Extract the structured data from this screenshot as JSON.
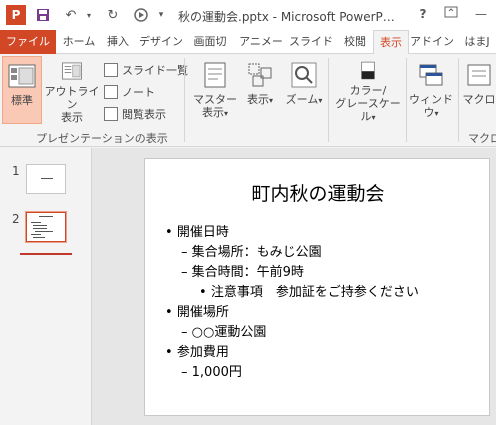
{
  "app": {
    "logo_letter": "P",
    "title": "秋の運動会.pptx - Microsoft PowerP…",
    "accent_color": "#d24726"
  },
  "window_buttons": {
    "help": "?"
  },
  "tabs": [
    {
      "label": "ファイル"
    },
    {
      "label": "ホーム"
    },
    {
      "label": "挿入"
    },
    {
      "label": "デザイン"
    },
    {
      "label": "画面切"
    },
    {
      "label": "アニメー"
    },
    {
      "label": "スライド"
    },
    {
      "label": "校閲"
    },
    {
      "label": "表示"
    },
    {
      "label": "アドイン"
    },
    {
      "label": "はまJ"
    }
  ],
  "ribbon": {
    "presentation_views": {
      "normal": "標準",
      "outline": "アウトライン表示",
      "outline_line1": "アウトライン",
      "outline_line2": "表示",
      "slide_sorter": "スライド一覧",
      "notes": "ノート",
      "reading": "閲覧表示",
      "group_label": "プレゼンテーションの表示"
    },
    "master_line1": "マスター",
    "master_line2": "表示",
    "show": "表示",
    "zoom": "ズーム",
    "color_line1": "カラー/",
    "color_line2": "グレースケール",
    "window": "ウィンドウ",
    "macro": "マクロ",
    "macro_group": "マクロ"
  },
  "thumbnails": [
    {
      "number": "1"
    },
    {
      "number": "2"
    }
  ],
  "slide": {
    "title": "町内秋の運動会",
    "bullets": [
      {
        "level": 1,
        "text": "開催日時"
      },
      {
        "level": 2,
        "text": "集合場所：もみじ公園"
      },
      {
        "level": 2,
        "text": "集合時間：午前9時"
      },
      {
        "level": 3,
        "text": "注意事項　参加証をご持参ください"
      },
      {
        "level": 1,
        "text": "開催場所"
      },
      {
        "level": 2,
        "text": "○○運動公園"
      },
      {
        "level": 1,
        "text": "参加費用"
      },
      {
        "level": 2,
        "text": "1,000円"
      }
    ]
  }
}
